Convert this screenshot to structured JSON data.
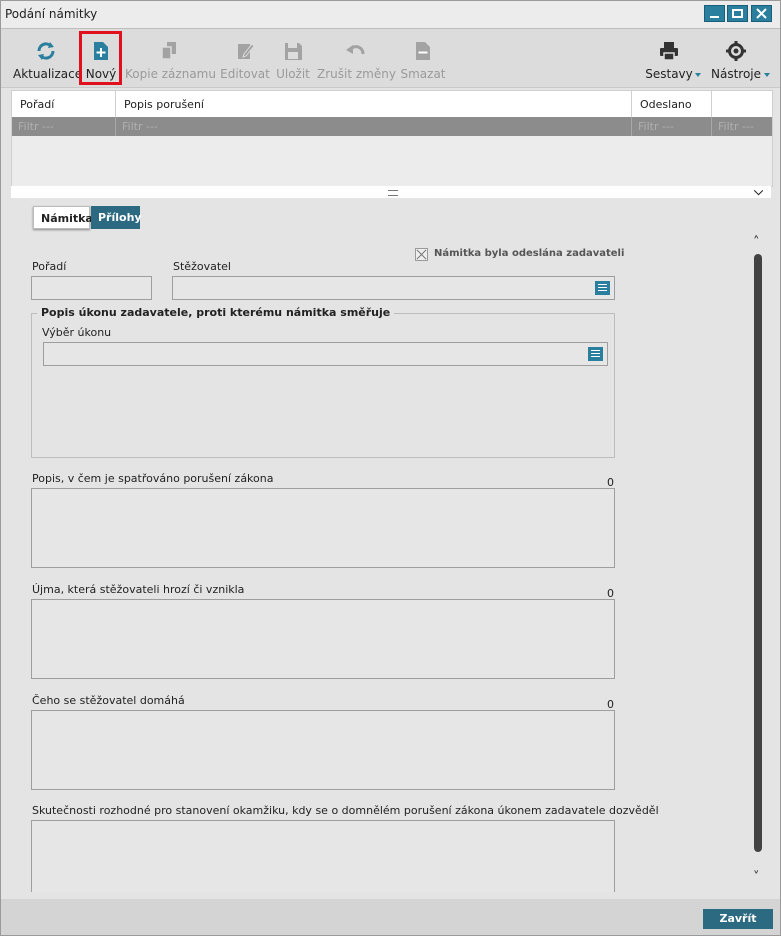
{
  "window": {
    "title": "Podání námitky",
    "controls": {
      "minimize": "minimize-icon",
      "maximize": "maximize-icon",
      "close": "close-icon"
    }
  },
  "toolbar": {
    "buttons": [
      {
        "label": "Aktualizace",
        "icon": "refresh-icon",
        "enabled": true
      },
      {
        "label": "Nový",
        "icon": "new-document-icon",
        "enabled": true,
        "highlighted": true
      },
      {
        "label": "Kopie záznamu",
        "icon": "copy-icon",
        "enabled": false
      },
      {
        "label": "Editovat",
        "icon": "edit-icon",
        "enabled": false
      },
      {
        "label": "Uložit",
        "icon": "save-icon",
        "enabled": false
      },
      {
        "label": "Zrušit změny",
        "icon": "undo-icon",
        "enabled": false
      },
      {
        "label": "Smazat",
        "icon": "delete-icon",
        "enabled": false
      }
    ],
    "right_buttons": [
      {
        "label": "Sestavy",
        "icon": "printer-icon"
      },
      {
        "label": "Nástroje",
        "icon": "gear-icon"
      }
    ]
  },
  "grid": {
    "columns": [
      "Pořadí",
      "Popis porušení",
      "Odeslano",
      ""
    ],
    "filter_placeholder": "Filtr ---"
  },
  "tabs": [
    "Námitka",
    "Přílohy"
  ],
  "form": {
    "checkbox_label": "Námitka byla odeslána zadavateli",
    "poradi_label": "Pořadí",
    "stezovatel_label": "Stěžovatel",
    "group_title": "Popis úkonu zadavatele, proti kterému námitka směřuje",
    "vyber_ukonu_label": "Výběr úkonu",
    "textareas": [
      {
        "label": "Popis, v čem je spatřováno porušení zákona",
        "count": "0"
      },
      {
        "label": "Újma, která stěžovateli hrozí či vznikla",
        "count": "0"
      },
      {
        "label": "Čeho se stěžovatel domáhá",
        "count": "0"
      },
      {
        "label": "Skutečnosti rozhodné pro stanovení okamžiku, kdy se o domnělém porušení zákona úkonem zadavatele dozvěděl",
        "count": ""
      }
    ]
  },
  "footer": {
    "close_label": "Zavřít"
  },
  "colors": {
    "accent": "#2a7f9e",
    "tab_active_dark": "#2c6a82",
    "highlight": "#e0101c"
  }
}
